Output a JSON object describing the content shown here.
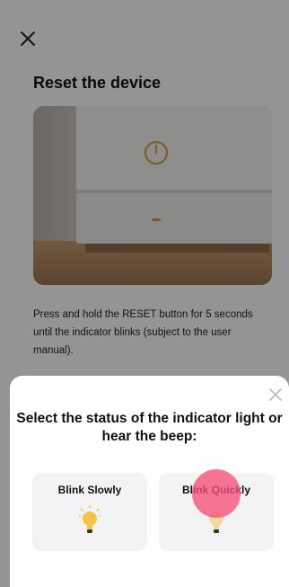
{
  "page": {
    "close_icon": "close-icon",
    "title": "Reset the device",
    "description": "Press and hold the RESET button for 5 seconds until the indicator blinks (subject to the user manual)."
  },
  "sheet": {
    "close_icon": "close-icon",
    "title": "Select the status of the indicator light or hear the beep:",
    "options": [
      {
        "label": "Blink Slowly",
        "icon": "lightbulb-glowing-icon"
      },
      {
        "label": "Blink Quickly",
        "icon": "lightbulb-icon"
      }
    ]
  },
  "colors": {
    "bulb_glow": "#f6c343",
    "overlay": "#000000",
    "touch_indicator": "#f55078"
  }
}
